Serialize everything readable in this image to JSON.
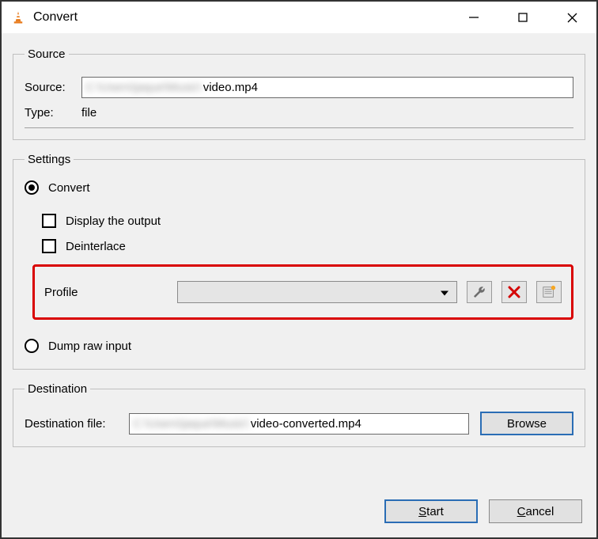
{
  "window": {
    "title": "Convert"
  },
  "source_group": {
    "legend": "Source",
    "source_label": "Source:",
    "source_value_blur": "C:\\Users\\jaque\\Music\\",
    "source_value_clear": "video.mp4",
    "type_label": "Type:",
    "type_value": "file"
  },
  "settings_group": {
    "legend": "Settings",
    "convert_label": "Convert",
    "display_output_label": "Display the output",
    "deinterlace_label": "Deinterlace",
    "profile_label": "Profile",
    "dump_raw_label": "Dump raw input"
  },
  "destination_group": {
    "legend": "Destination",
    "dest_label": "Destination file:",
    "dest_value_blur": "C:\\Users\\jaque\\Music\\",
    "dest_value_clear": "video-converted.mp4",
    "browse_label": "Browse"
  },
  "actions": {
    "start_label": "Start",
    "cancel_label": "Cancel"
  }
}
